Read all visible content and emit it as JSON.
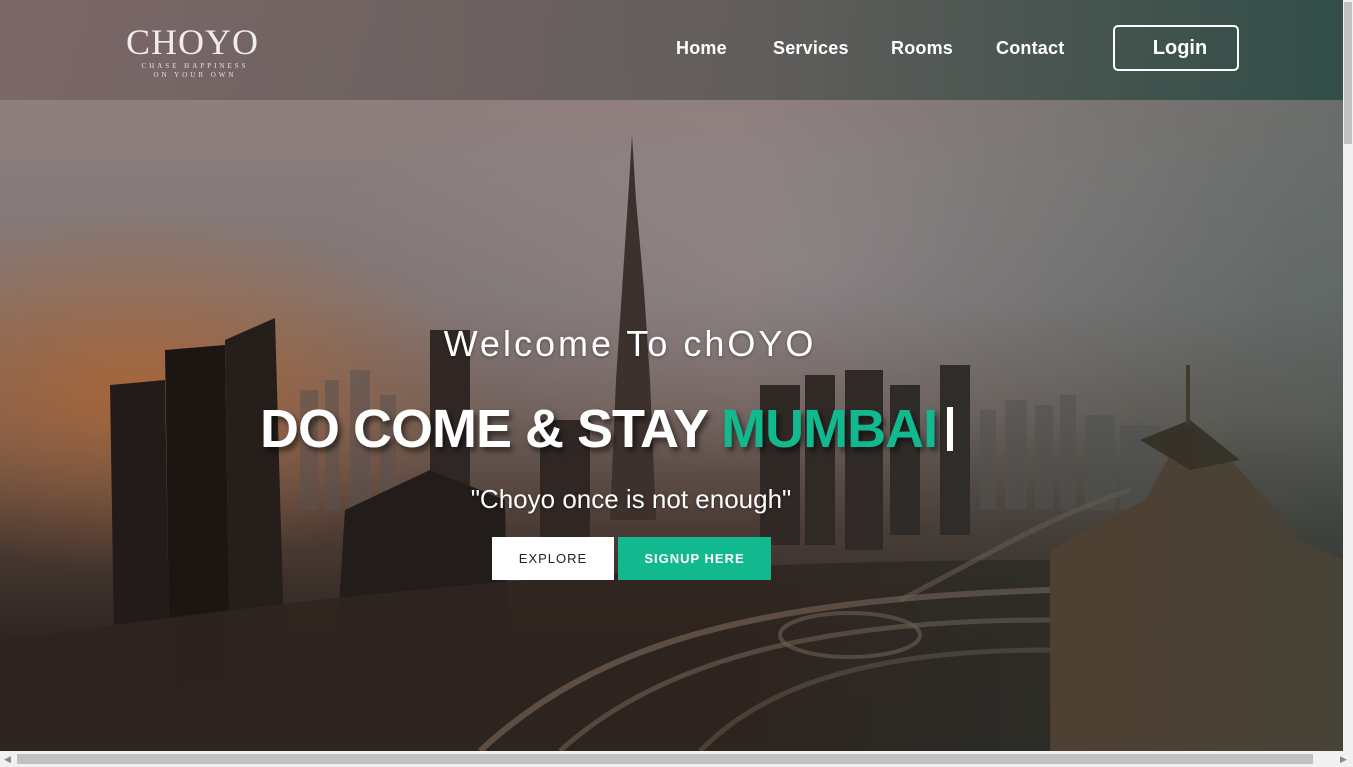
{
  "header": {
    "logo_text": "CHOYO",
    "logo_tagline_1": "CHASE HAPPINESS",
    "logo_tagline_2": "ON YOUR OWN",
    "nav": [
      {
        "label": "Home"
      },
      {
        "label": "Services"
      },
      {
        "label": "Rooms"
      },
      {
        "label": "Contact"
      }
    ],
    "login_label": "Login"
  },
  "hero": {
    "welcome": "Welcome To chOYO",
    "headline_prefix": "DO COME & STAY",
    "headline_city": "MUMBAI",
    "tagline": "\"Choyo once is not enough\"",
    "explore_label": "EXPLORE",
    "signup_label": "SIGNUP HERE"
  },
  "colors": {
    "accent": "#13b98e",
    "header_left": "#786464",
    "header_right": "#2d4b44"
  },
  "icons": {
    "scroll_left": "chevron-left-icon",
    "scroll_right": "chevron-right-icon"
  }
}
